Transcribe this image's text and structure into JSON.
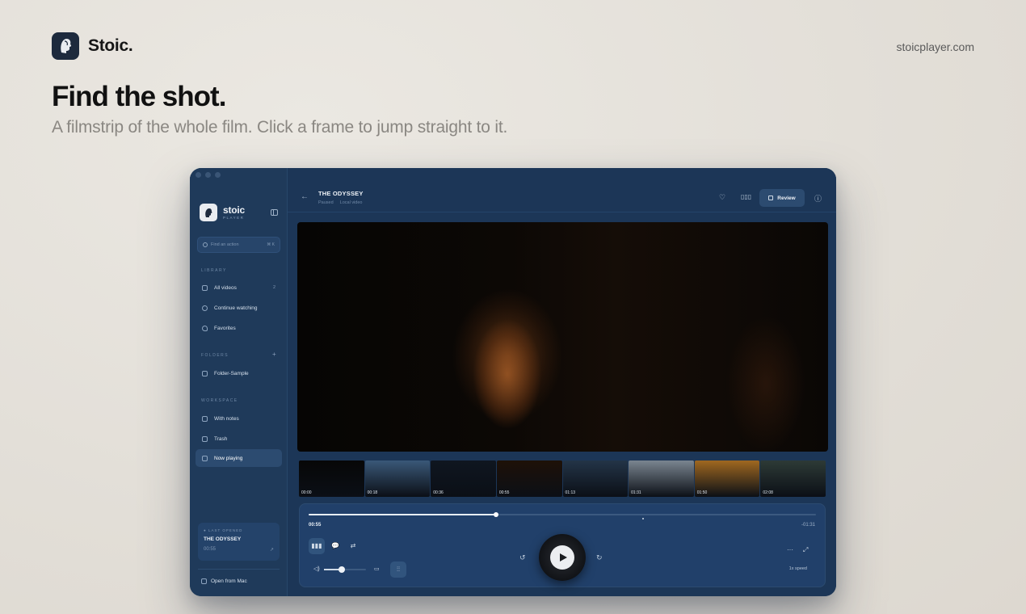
{
  "page": {
    "brand_name": "Stoic.",
    "site_link": "stoicplayer.com",
    "headline": "Find the shot.",
    "subheadline": "A filmstrip of the whole film. Click a frame to jump straight to it."
  },
  "app": {
    "title": "stoic",
    "subtitle": "PLAYER",
    "search": {
      "placeholder": "Find an action",
      "shortcut": "⌘ K"
    },
    "sections": {
      "library": "LIBRARY",
      "folders": "FOLDERS",
      "workspace": "WORKSPACE"
    },
    "library_items": [
      {
        "label": "All videos",
        "count": "2",
        "icon": "grid-icon"
      },
      {
        "label": "Continue watching",
        "count": "",
        "icon": "clock-icon"
      },
      {
        "label": "Favorites",
        "count": "",
        "icon": "heart-icon"
      }
    ],
    "folder_items": [
      {
        "label": "Folder-Sample",
        "icon": "folder-icon"
      }
    ],
    "workspace_items": [
      {
        "label": "With notes",
        "icon": "bookmark-icon"
      },
      {
        "label": "Trash",
        "icon": "trash-icon"
      },
      {
        "label": "Now playing",
        "icon": "play-square-icon",
        "active": true
      }
    ],
    "last_opened": {
      "tag": "LAST OPENED",
      "title": "THE ODYSSEY",
      "time": "00:55"
    },
    "open_from": "Open from Mac"
  },
  "video": {
    "title": "THE ODYSSEY",
    "status": "Paused",
    "source": "Local video",
    "review_label": "Review",
    "progress": 0.37,
    "volume": 0.42,
    "current_time": "00:55",
    "remaining_time": "-01:31",
    "speed": "1x speed"
  },
  "filmstrip": [
    {
      "time": "00:00",
      "color": "#070707"
    },
    {
      "time": "00:18",
      "color": "#3a5878"
    },
    {
      "time": "00:36",
      "color": "#0f1620"
    },
    {
      "time": "00:55",
      "color": "#1e1108"
    },
    {
      "time": "01:13",
      "color": "#233447"
    },
    {
      "time": "01:31",
      "color": "#7a8590"
    },
    {
      "time": "01:50",
      "color": "#a06820"
    },
    {
      "time": "02:08",
      "color": "#2d3a36"
    }
  ],
  "colors": {
    "sidebar": "#1f3a5a",
    "main": "#1c3657",
    "accent": "#2c4b70"
  }
}
